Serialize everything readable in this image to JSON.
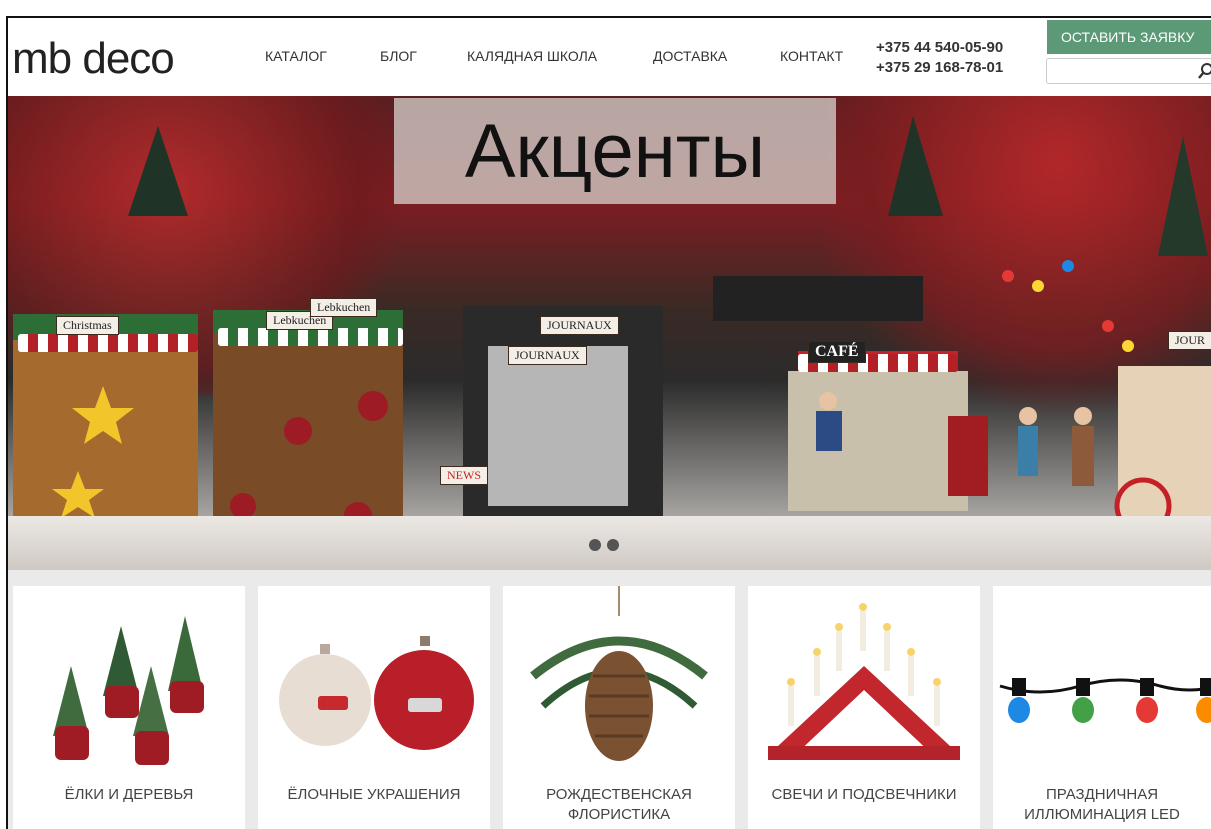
{
  "header": {
    "logo": "mb deco",
    "nav": [
      {
        "label": "КАТАЛОГ"
      },
      {
        "label": "БЛОГ"
      },
      {
        "label": "КАЛЯДНАЯ ШКОЛА"
      },
      {
        "label": "ДОСТАВКА"
      },
      {
        "label": "КОНТАКТ"
      }
    ],
    "phones": [
      "+375 44 540-05-90",
      "+375 29 168-78-01"
    ],
    "cta_label": "ОСТАВИТЬ ЗАЯВКУ",
    "search_placeholder": ""
  },
  "hero": {
    "title": "Акценты",
    "signs": [
      "Christmas",
      "Lebkuchen",
      "Lebkuchen",
      "JOURNAUX",
      "JOURNAUX",
      "CAFÉ",
      "NEWS",
      "JOUR"
    ],
    "slide_count": 2,
    "active_slide": 1
  },
  "categories": [
    {
      "label": "ЁЛКИ И ДЕРЕВЬЯ",
      "icon": "potted-trees"
    },
    {
      "label": "ЁЛОЧНЫЕ УКРАШЕНИЯ",
      "icon": "christmas-balls"
    },
    {
      "label": "РОЖДЕСТВЕНСКАЯ ФЛОРИСТИКА",
      "icon": "pine-cone"
    },
    {
      "label": "СВЕЧИ И ПОДСВЕЧНИКИ",
      "icon": "candle-arch"
    },
    {
      "label": "ПРАЗДНИЧНАЯ ИЛЛЮМИНАЦИЯ LED",
      "icon": "string-lights"
    }
  ],
  "colors": {
    "accent": "#5c9977",
    "hero_red": "#7e1d22"
  }
}
